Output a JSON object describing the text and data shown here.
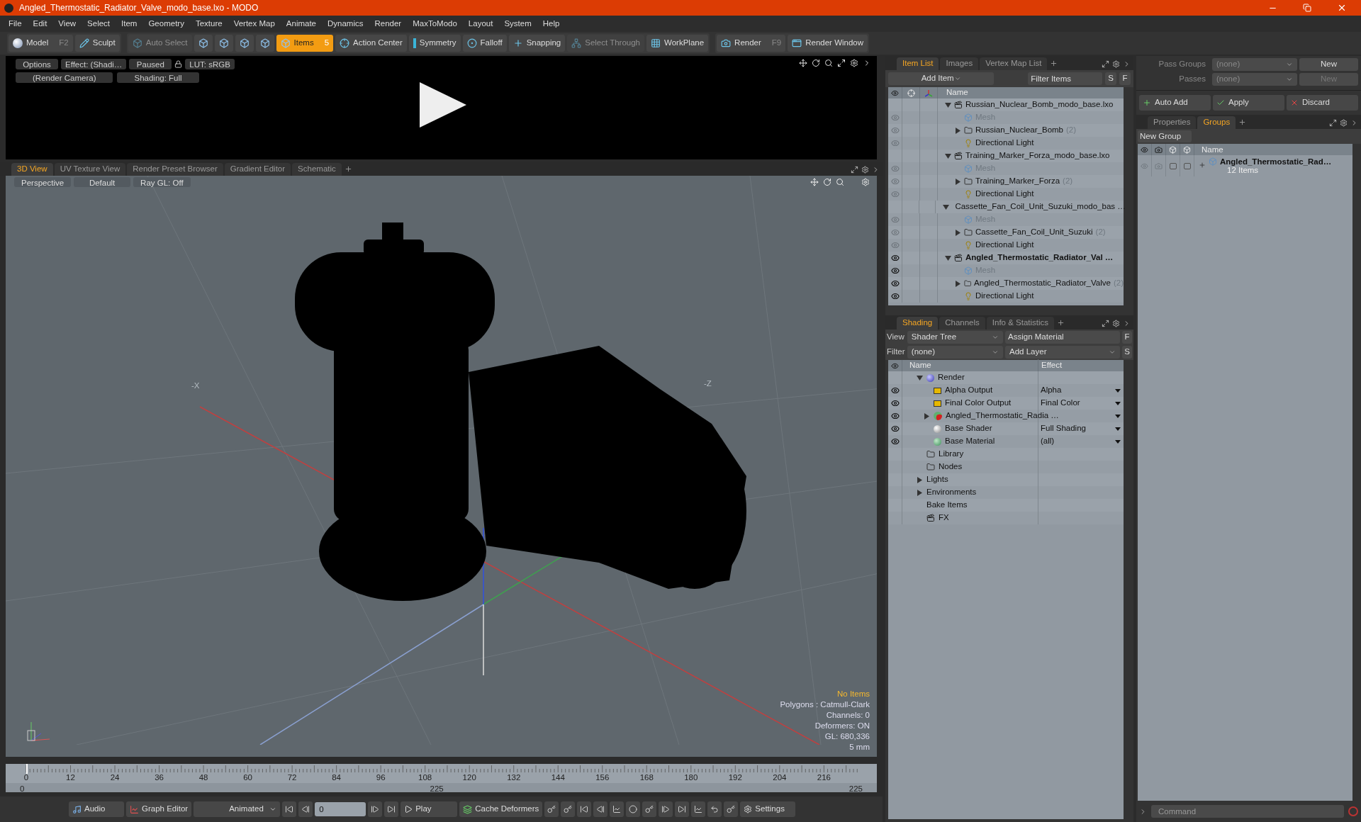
{
  "window": {
    "title": "Angled_Thermostatic_Radiator_Valve_modo_base.lxo - MODO"
  },
  "menu": [
    "File",
    "Edit",
    "View",
    "Select",
    "Item",
    "Geometry",
    "Texture",
    "Vertex Map",
    "Animate",
    "Dynamics",
    "Render",
    "MaxToModo",
    "Layout",
    "System",
    "Help"
  ],
  "toolbar": [
    [
      {
        "kind": "model",
        "label": "Model",
        "shortcut": "F2",
        "selected": false,
        "disabled": false
      },
      {
        "kind": "sculpt",
        "label": "Sculpt",
        "selected": false,
        "disabled": false
      }
    ],
    [
      {
        "kind": "auto-select",
        "label": "Auto Select",
        "selected": false,
        "disabled": true
      },
      {
        "kind": "cube",
        "selected": false,
        "disabled": false
      },
      {
        "kind": "cube",
        "selected": false,
        "disabled": false
      },
      {
        "kind": "cube",
        "selected": false,
        "disabled": false
      },
      {
        "kind": "cube",
        "selected": false,
        "disabled": false
      },
      {
        "kind": "items",
        "label": "Items",
        "shortcut": "5",
        "selected": true,
        "disabled": false
      },
      {
        "kind": "action-center",
        "label": "Action Center",
        "selected": false,
        "disabled": false
      },
      {
        "kind": "symmetry",
        "label": "Symmetry",
        "selected": false,
        "disabled": false
      },
      {
        "kind": "falloff",
        "label": "Falloff",
        "selected": false,
        "disabled": false
      },
      {
        "kind": "snapping",
        "label": "Snapping",
        "selected": false,
        "disabled": false
      },
      {
        "kind": "select-through",
        "label": "Select Through",
        "selected": false,
        "disabled": true
      },
      {
        "kind": "workplane",
        "label": "WorkPlane",
        "selected": false,
        "disabled": false
      }
    ],
    [
      {
        "kind": "render",
        "label": "Render",
        "shortcut": "F9",
        "selected": false,
        "disabled": false
      },
      {
        "kind": "render-window",
        "label": "Render Window",
        "selected": false,
        "disabled": false
      }
    ]
  ],
  "preview": {
    "row_1": [
      {
        "kind": "button",
        "label": "Options"
      },
      {
        "kind": "button",
        "label": "Effect: (Shadi…"
      },
      {
        "kind": "button",
        "label": "Paused"
      },
      {
        "kind": "lock"
      },
      {
        "kind": "button",
        "label": "LUT: sRGB"
      }
    ],
    "row_2": [
      {
        "kind": "button",
        "label": "(Render Camera)"
      },
      {
        "kind": "button",
        "label": "Shading: Full"
      }
    ]
  },
  "view_tabs": [
    {
      "label": "3D View",
      "selected": true
    },
    {
      "label": "UV Texture View",
      "selected": false
    },
    {
      "label": "Render Preset Browser",
      "selected": false
    },
    {
      "label": "Gradient Editor",
      "selected": false
    },
    {
      "label": "Schematic",
      "selected": false
    }
  ],
  "viewport": {
    "buttons": [
      "Perspective",
      "Default",
      "Ray GL: Off"
    ],
    "axis_labels": [
      "-X",
      "-Z"
    ],
    "info": [
      {
        "text": "No Items",
        "highlight": true
      },
      {
        "text": "Polygons : Catmull-Clark",
        "highlight": false
      },
      {
        "text": "Channels: 0",
        "highlight": false
      },
      {
        "text": "Deformers: ON",
        "highlight": false
      },
      {
        "text": "GL: 680,336",
        "highlight": false
      },
      {
        "text": "5 mm",
        "highlight": false
      }
    ]
  },
  "timeline": {
    "ticks": [
      "0",
      "12",
      "24",
      "36",
      "48",
      "60",
      "72",
      "84",
      "96",
      "108",
      "120",
      "132",
      "144",
      "156",
      "168",
      "180",
      "192",
      "204",
      "216"
    ],
    "range": [
      "0",
      "225",
      "225"
    ]
  },
  "bottom_bar": [
    {
      "kind": "audio",
      "label": "Audio"
    },
    {
      "kind": "graph",
      "label": "Graph Editor"
    },
    {
      "kind": "dropdown",
      "label": "Animated"
    },
    {
      "kind": "first"
    },
    {
      "kind": "prev"
    },
    {
      "kind": "frame",
      "value": "0"
    },
    {
      "kind": "next"
    },
    {
      "kind": "last"
    },
    {
      "kind": "play",
      "label": "Play"
    },
    {
      "kind": "cache",
      "label": "Cache Deformers"
    },
    {
      "kind": "key"
    },
    {
      "kind": "key"
    },
    {
      "kind": "first"
    },
    {
      "kind": "prev"
    },
    {
      "kind": "curve"
    },
    {
      "kind": "record"
    },
    {
      "kind": "key"
    },
    {
      "kind": "next"
    },
    {
      "kind": "last"
    },
    {
      "kind": "curve"
    },
    {
      "kind": "undo"
    },
    {
      "kind": "key"
    },
    {
      "kind": "settings",
      "label": "Settings"
    }
  ],
  "item_list": {
    "tabs": [
      {
        "label": "Item List",
        "selected": true
      },
      {
        "label": "Images",
        "selected": false
      },
      {
        "label": "Vertex Map List",
        "selected": false
      }
    ],
    "add_item": "Add Item",
    "filter": "Filter Items",
    "keys": [
      "S",
      "F"
    ],
    "column": "Name",
    "items": [
      {
        "kind": "scene",
        "label": "Russian_Nuclear_Bomb_modo_base.lxo",
        "visible": false,
        "current": false,
        "expanded": true,
        "children": [
          {
            "kind": "mesh",
            "label": "Mesh",
            "visible": false
          },
          {
            "kind": "group",
            "label": "Russian_Nuclear_Bomb",
            "count": "(2)",
            "visible": false,
            "expanded": false
          },
          {
            "kind": "light",
            "label": "Directional Light",
            "visible": false
          }
        ]
      },
      {
        "kind": "scene",
        "label": "Training_Marker_Forza_modo_base.lxo",
        "visible": false,
        "current": false,
        "expanded": true,
        "children": [
          {
            "kind": "mesh",
            "label": "Mesh",
            "visible": false
          },
          {
            "kind": "group",
            "label": "Training_Marker_Forza",
            "count": "(2)",
            "visible": false,
            "expanded": false
          },
          {
            "kind": "light",
            "label": "Directional Light",
            "visible": false
          }
        ]
      },
      {
        "kind": "scene",
        "label": "Cassette_Fan_Coil_Unit_Suzuki_modo_bas …",
        "visible": false,
        "current": false,
        "expanded": true,
        "children": [
          {
            "kind": "mesh",
            "label": "Mesh",
            "visible": false
          },
          {
            "kind": "group",
            "label": "Cassette_Fan_Coil_Unit_Suzuki",
            "count": "(2)",
            "visible": false,
            "expanded": false
          },
          {
            "kind": "light",
            "label": "Directional Light",
            "visible": false
          }
        ]
      },
      {
        "kind": "scene",
        "label": "Angled_Thermostatic_Radiator_Val …",
        "visible": true,
        "current": true,
        "expanded": true,
        "children": [
          {
            "kind": "mesh",
            "label": "Mesh",
            "visible": true
          },
          {
            "kind": "group",
            "label": "Angled_Thermostatic_Radiator_Valve",
            "count": "(2)",
            "visible": true,
            "expanded": false
          },
          {
            "kind": "light",
            "label": "Directional Light",
            "visible": true
          }
        ]
      }
    ]
  },
  "shading": {
    "tabs": [
      {
        "label": "Shading",
        "selected": true
      },
      {
        "label": "Channels",
        "selected": false
      },
      {
        "label": "Info & Statistics",
        "selected": false
      }
    ],
    "view_label": "View",
    "view": "Shader Tree",
    "assign": "Assign Material",
    "assign_key": "F",
    "filter_label": "Filter",
    "filter": "(none)",
    "add_layer": "Add Layer",
    "filter_key": "S",
    "columns": [
      "Name",
      "Effect"
    ],
    "items": [
      {
        "kind": "render",
        "label": "Render",
        "eye": false,
        "menu": false,
        "expanded": true,
        "children": [
          {
            "kind": "output",
            "label": "Alpha Output",
            "effect": "Alpha",
            "eye": true,
            "menu": true
          },
          {
            "kind": "output",
            "label": "Final Color Output",
            "effect": "Final Color",
            "eye": true,
            "menu": true
          },
          {
            "kind": "mask",
            "label": "Angled_Thermostatic_Radia …",
            "eye": true,
            "menu": true,
            "expanded": false
          },
          {
            "kind": "shader",
            "label": "Base Shader",
            "effect": "Full Shading",
            "eye": true,
            "menu": true
          },
          {
            "kind": "material",
            "label": "Base Material",
            "effect": "(all)",
            "eye": true,
            "menu": true
          }
        ]
      },
      {
        "kind": "folder",
        "label": "Library",
        "eye": false,
        "menu": false
      },
      {
        "kind": "folder",
        "label": "Nodes",
        "eye": false,
        "menu": false
      },
      {
        "kind": "category",
        "label": "Lights",
        "eye": false,
        "menu": false,
        "expanded": false
      },
      {
        "kind": "category",
        "label": "Environments",
        "eye": false,
        "menu": false,
        "expanded": false
      },
      {
        "kind": "plain",
        "label": "Bake Items",
        "eye": false,
        "menu": false
      },
      {
        "kind": "fx",
        "label": "FX",
        "eye": false,
        "menu": false
      }
    ]
  },
  "passes": [
    {
      "label": "Pass Groups",
      "value": "(none)",
      "button": "New",
      "disabled": false
    },
    {
      "label": "Passes",
      "value": "(none)",
      "button": "New",
      "disabled": true
    }
  ],
  "group_actions": [
    {
      "kind": "add",
      "label": "Auto Add"
    },
    {
      "kind": "apply",
      "label": "Apply"
    },
    {
      "kind": "discard",
      "label": "Discard"
    }
  ],
  "groups": {
    "tabs": [
      {
        "label": "Properties",
        "selected": false
      },
      {
        "label": "Groups",
        "selected": true
      }
    ],
    "new_group": "New Group",
    "column": "Name",
    "rows": [
      {
        "label": "Angled_Thermostatic_Rad…",
        "sub": "12 Items",
        "toggles": [
          {
            "checked": false
          },
          {
            "checked": false
          }
        ]
      }
    ]
  },
  "command": {
    "placeholder": "Command"
  }
}
